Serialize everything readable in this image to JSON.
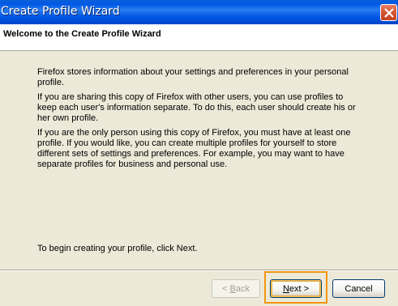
{
  "window": {
    "title": "Create Profile Wizard",
    "close_icon": "close-icon"
  },
  "header": {
    "title": "Welcome to the Create Profile Wizard"
  },
  "body": {
    "paragraphs": [
      "Firefox stores information about your settings and preferences in your personal profile.",
      "If you are sharing this copy of Firefox with other users, you can use profiles to keep each user's information separate. To do this, each user should create his or her own profile.",
      "If you are the only person using this copy of Firefox, you must have at least one profile. If you would like, you can create multiple profiles for yourself to store different sets of settings and preferences. For example, you may want to have separate profiles for business and personal use."
    ],
    "instruction": "To begin creating your profile, click Next."
  },
  "buttons": {
    "back_prefix": "< ",
    "back_access": "B",
    "back_rest": "ack",
    "next_access": "N",
    "next_rest": "ext >",
    "cancel": "Cancel"
  },
  "colors": {
    "titlebar": "#0055e5",
    "dialog_bg": "#ece9d8",
    "highlight": "#f29611"
  }
}
